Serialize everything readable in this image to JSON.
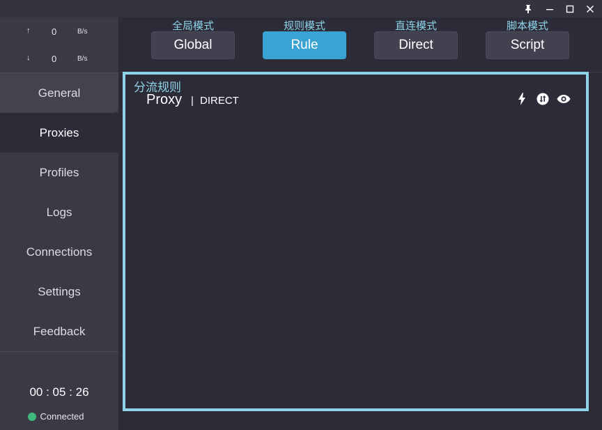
{
  "titlebar": {
    "icons": [
      "pin-icon",
      "minimize-icon",
      "maximize-icon",
      "close-icon"
    ]
  },
  "sidebar": {
    "speed": {
      "up": {
        "arrow": "↑",
        "value": "0",
        "unit": "B/s"
      },
      "down": {
        "arrow": "↓",
        "value": "0",
        "unit": "B/s"
      }
    },
    "items": [
      {
        "label": "General"
      },
      {
        "label": "Proxies"
      },
      {
        "label": "Profiles"
      },
      {
        "label": "Logs"
      },
      {
        "label": "Connections"
      },
      {
        "label": "Settings"
      },
      {
        "label": "Feedback"
      }
    ],
    "active_item": "Proxies",
    "timer": "00 : 05 : 26",
    "status": "Connected"
  },
  "modes": [
    {
      "label_cn": "全局模式",
      "button": "Global"
    },
    {
      "label_cn": "规则模式",
      "button": "Rule"
    },
    {
      "label_cn": "直连模式",
      "button": "Direct"
    },
    {
      "label_cn": "脚本模式",
      "button": "Script"
    }
  ],
  "selected_mode": "Rule",
  "panel": {
    "title": "分流规则",
    "group_name": "Proxy",
    "separator": "|",
    "current": "DIRECT",
    "icons": [
      "bolt-icon",
      "switch-icon",
      "eye-icon"
    ]
  },
  "colors": {
    "accent": "#39a3d3",
    "highlight": "#8fd3e8",
    "background": "#2c2b38",
    "sidebar": "#3a3a47",
    "connected": "#3fb77b"
  }
}
